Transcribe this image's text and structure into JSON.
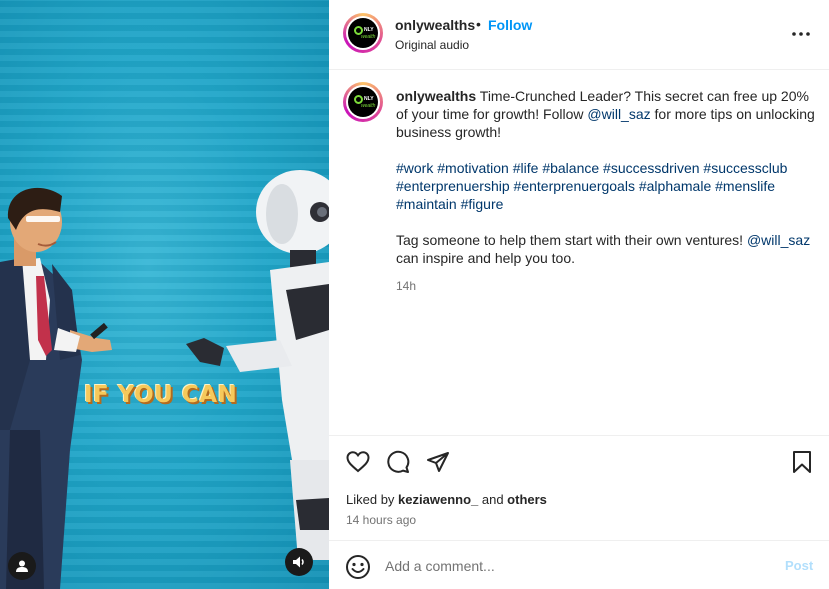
{
  "header": {
    "username": "onlywealths",
    "separator": "•",
    "follow_label": "Follow",
    "audio_label": "Original audio",
    "avatar_icon": "onlywealths-logo",
    "more_icon": "more-horizontal-icon"
  },
  "media": {
    "overlay_text": "IF YOU CAN",
    "user_icon": "user-icon",
    "sound_icon": "speaker-icon"
  },
  "caption": {
    "username": "onlywealths",
    "text_1": "Time-Crunched Leader? This secret can free up 20% of your time for growth! Follow ",
    "mention_1": "@will_saz",
    "text_2": " for more tips on unlocking business growth!",
    "hashtags": [
      "#work",
      "#motivation",
      "#life",
      "#balance",
      "#successdriven",
      "#successclub",
      "#enterprenuership",
      "#enterprenuergoals",
      "#alphamale",
      "#menslife",
      "#maintain",
      "#figure"
    ],
    "text_3": "Tag someone to help them start with their own ventures! ",
    "mention_2": "@will_saz",
    "text_4": " can inspire and help you too.",
    "time": "14h"
  },
  "actions": {
    "like_icon": "heart-icon",
    "comment_icon": "comment-icon",
    "share_icon": "share-icon",
    "save_icon": "bookmark-icon"
  },
  "likes": {
    "prefix": "Liked by ",
    "user": "keziawenno_",
    "middle": " and ",
    "others": "others"
  },
  "posted": "14 hours ago",
  "comment": {
    "emoji_icon": "emoji-icon",
    "placeholder": "Add a comment...",
    "post_label": "Post"
  },
  "colors": {
    "accent": "#0095f6",
    "link": "#00376b",
    "media_bg": "#20a6c9",
    "overlay_text": "#f6c95b"
  }
}
